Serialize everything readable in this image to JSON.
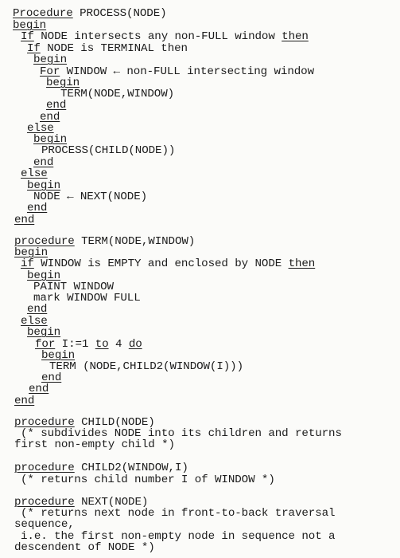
{
  "document": {
    "procedures": [
      {
        "name": "PROCESS",
        "lines": [
          [
            {
              "t": "Procedure",
              "kw": true
            },
            {
              "t": " PROCESS(NODE)"
            }
          ],
          [
            {
              "t": "begin",
              "kw": true
            }
          ],
          [
            {
              "t": "If",
              "kw": true
            },
            {
              "t": " NODE intersects any non-FULL window "
            },
            {
              "t": "then",
              "kw": true
            }
          ],
          [
            {
              "t": "If",
              "kw": true
            },
            {
              "t": " NODE is TERMINAL then"
            }
          ],
          [
            {
              "t": "begin",
              "kw": true
            }
          ],
          [
            {
              "t": "For",
              "kw": true
            },
            {
              "t": " WINDOW ← non-FULL intersecting window"
            }
          ],
          [
            {
              "t": "begin",
              "kw": true
            }
          ],
          [
            {
              "t": "TERM(NODE,WINDOW)"
            }
          ],
          [
            {
              "t": "end",
              "kw": true
            }
          ],
          [
            {
              "t": "end",
              "kw": true
            }
          ],
          [
            {
              "t": "else",
              "kw": true
            }
          ],
          [
            {
              "t": "begin",
              "kw": true
            }
          ],
          [
            {
              "t": "PROCESS(CHILD(NODE))"
            }
          ],
          [
            {
              "t": "end",
              "kw": true
            }
          ],
          [
            {
              "t": "else",
              "kw": true
            }
          ],
          [
            {
              "t": "begin",
              "kw": true
            }
          ],
          [
            {
              "t": "NODE ← NEXT(NODE)"
            }
          ],
          [
            {
              "t": "end",
              "kw": true
            }
          ],
          [
            {
              "t": "end",
              "kw": true
            }
          ]
        ]
      },
      {
        "name": "TERM",
        "lines": [
          [
            {
              "t": "procedure",
              "kw": true
            },
            {
              "t": " TERM(NODE,WINDOW)"
            }
          ],
          [
            {
              "t": "begin",
              "kw": true
            }
          ],
          [
            {
              "t": "if",
              "kw": true
            },
            {
              "t": " WINDOW is EMPTY and enclosed by NODE "
            },
            {
              "t": "then",
              "kw": true
            }
          ],
          [
            {
              "t": "begin",
              "kw": true
            }
          ],
          [
            {
              "t": "PAINT WINDOW"
            }
          ],
          [
            {
              "t": "mark WINDOW FULL"
            }
          ],
          [
            {
              "t": "end",
              "kw": true
            }
          ],
          [
            {
              "t": "else",
              "kw": true
            }
          ],
          [
            {
              "t": "begin",
              "kw": true
            }
          ],
          [
            {
              "t": "for",
              "kw": true
            },
            {
              "t": " I:=1 "
            },
            {
              "t": "to",
              "kw": true
            },
            {
              "t": " 4 "
            },
            {
              "t": "do",
              "kw": true
            }
          ],
          [
            {
              "t": "begin",
              "kw": true
            }
          ],
          [
            {
              "t": "TERM (NODE,CHILD2(WINDOW(I)))"
            }
          ],
          [
            {
              "t": "end",
              "kw": true
            }
          ],
          [
            {
              "t": "end",
              "kw": true
            }
          ],
          [
            {
              "t": "end",
              "kw": true
            }
          ]
        ]
      },
      {
        "name": "CHILD",
        "lines": [
          [
            {
              "t": "procedure",
              "kw": true
            },
            {
              "t": " CHILD(NODE)"
            }
          ],
          [
            {
              "t": "(* subdivides NODE into its children and returns"
            }
          ],
          [
            {
              "t": "first non-empty child *)"
            }
          ]
        ]
      },
      {
        "name": "CHILD2",
        "lines": [
          [
            {
              "t": "procedure",
              "kw": true
            },
            {
              "t": " CHILD2(WINDOW,I)"
            }
          ],
          [
            {
              "t": "(* returns child number I of WINDOW *)"
            }
          ]
        ]
      },
      {
        "name": "NEXT",
        "lines": [
          [
            {
              "t": "procedure",
              "kw": true
            },
            {
              "t": " NEXT(NODE)"
            }
          ],
          [
            {
              "t": "(* returns next node in front-to-back traversal"
            }
          ],
          [
            {
              "t": "sequence,"
            }
          ],
          [
            {
              "t": "i.e. the first non-empty node in sequence not a"
            }
          ],
          [
            {
              "t": "descendent of NODE *)"
            }
          ]
        ]
      }
    ]
  }
}
